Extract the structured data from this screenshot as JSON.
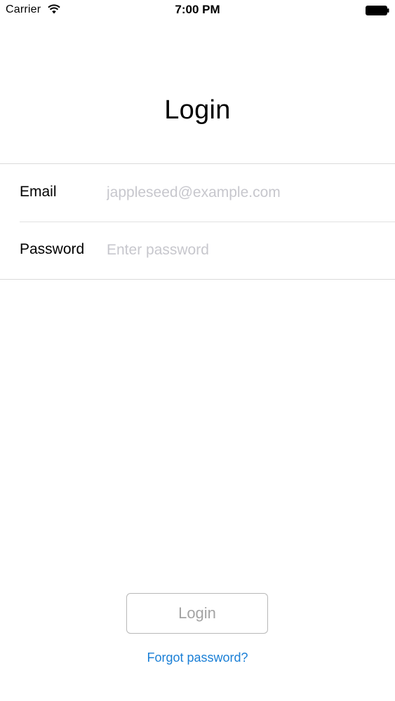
{
  "status_bar": {
    "carrier": "Carrier",
    "time": "7:00 PM"
  },
  "title": "Login",
  "form": {
    "email": {
      "label": "Email",
      "value": "",
      "placeholder": "jappleseed@example.com"
    },
    "password": {
      "label": "Password",
      "value": "",
      "placeholder": "Enter password"
    }
  },
  "actions": {
    "login_label": "Login",
    "forgot_label": "Forgot password?"
  },
  "colors": {
    "link": "#1a7fd6",
    "placeholder": "#c7c7cd",
    "button_text_disabled": "#a3a3a3"
  }
}
